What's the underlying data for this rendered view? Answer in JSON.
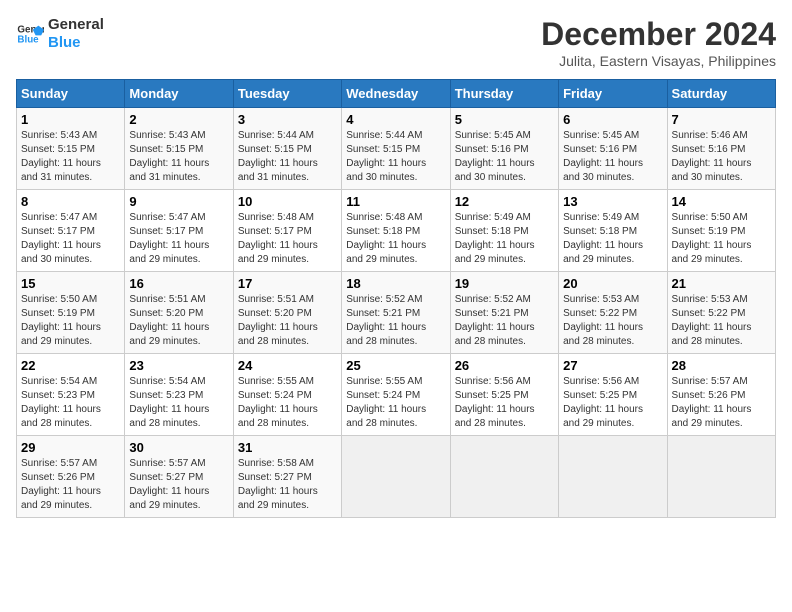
{
  "logo": {
    "line1": "General",
    "line2": "Blue"
  },
  "title": "December 2024",
  "subtitle": "Julita, Eastern Visayas, Philippines",
  "days_of_week": [
    "Sunday",
    "Monday",
    "Tuesday",
    "Wednesday",
    "Thursday",
    "Friday",
    "Saturday"
  ],
  "weeks": [
    [
      {
        "day": 1,
        "info": "Sunrise: 5:43 AM\nSunset: 5:15 PM\nDaylight: 11 hours\nand 31 minutes."
      },
      {
        "day": 2,
        "info": "Sunrise: 5:43 AM\nSunset: 5:15 PM\nDaylight: 11 hours\nand 31 minutes."
      },
      {
        "day": 3,
        "info": "Sunrise: 5:44 AM\nSunset: 5:15 PM\nDaylight: 11 hours\nand 31 minutes."
      },
      {
        "day": 4,
        "info": "Sunrise: 5:44 AM\nSunset: 5:15 PM\nDaylight: 11 hours\nand 30 minutes."
      },
      {
        "day": 5,
        "info": "Sunrise: 5:45 AM\nSunset: 5:16 PM\nDaylight: 11 hours\nand 30 minutes."
      },
      {
        "day": 6,
        "info": "Sunrise: 5:45 AM\nSunset: 5:16 PM\nDaylight: 11 hours\nand 30 minutes."
      },
      {
        "day": 7,
        "info": "Sunrise: 5:46 AM\nSunset: 5:16 PM\nDaylight: 11 hours\nand 30 minutes."
      }
    ],
    [
      {
        "day": 8,
        "info": "Sunrise: 5:47 AM\nSunset: 5:17 PM\nDaylight: 11 hours\nand 30 minutes."
      },
      {
        "day": 9,
        "info": "Sunrise: 5:47 AM\nSunset: 5:17 PM\nDaylight: 11 hours\nand 29 minutes."
      },
      {
        "day": 10,
        "info": "Sunrise: 5:48 AM\nSunset: 5:17 PM\nDaylight: 11 hours\nand 29 minutes."
      },
      {
        "day": 11,
        "info": "Sunrise: 5:48 AM\nSunset: 5:18 PM\nDaylight: 11 hours\nand 29 minutes."
      },
      {
        "day": 12,
        "info": "Sunrise: 5:49 AM\nSunset: 5:18 PM\nDaylight: 11 hours\nand 29 minutes."
      },
      {
        "day": 13,
        "info": "Sunrise: 5:49 AM\nSunset: 5:18 PM\nDaylight: 11 hours\nand 29 minutes."
      },
      {
        "day": 14,
        "info": "Sunrise: 5:50 AM\nSunset: 5:19 PM\nDaylight: 11 hours\nand 29 minutes."
      }
    ],
    [
      {
        "day": 15,
        "info": "Sunrise: 5:50 AM\nSunset: 5:19 PM\nDaylight: 11 hours\nand 29 minutes."
      },
      {
        "day": 16,
        "info": "Sunrise: 5:51 AM\nSunset: 5:20 PM\nDaylight: 11 hours\nand 29 minutes."
      },
      {
        "day": 17,
        "info": "Sunrise: 5:51 AM\nSunset: 5:20 PM\nDaylight: 11 hours\nand 28 minutes."
      },
      {
        "day": 18,
        "info": "Sunrise: 5:52 AM\nSunset: 5:21 PM\nDaylight: 11 hours\nand 28 minutes."
      },
      {
        "day": 19,
        "info": "Sunrise: 5:52 AM\nSunset: 5:21 PM\nDaylight: 11 hours\nand 28 minutes."
      },
      {
        "day": 20,
        "info": "Sunrise: 5:53 AM\nSunset: 5:22 PM\nDaylight: 11 hours\nand 28 minutes."
      },
      {
        "day": 21,
        "info": "Sunrise: 5:53 AM\nSunset: 5:22 PM\nDaylight: 11 hours\nand 28 minutes."
      }
    ],
    [
      {
        "day": 22,
        "info": "Sunrise: 5:54 AM\nSunset: 5:23 PM\nDaylight: 11 hours\nand 28 minutes."
      },
      {
        "day": 23,
        "info": "Sunrise: 5:54 AM\nSunset: 5:23 PM\nDaylight: 11 hours\nand 28 minutes."
      },
      {
        "day": 24,
        "info": "Sunrise: 5:55 AM\nSunset: 5:24 PM\nDaylight: 11 hours\nand 28 minutes."
      },
      {
        "day": 25,
        "info": "Sunrise: 5:55 AM\nSunset: 5:24 PM\nDaylight: 11 hours\nand 28 minutes."
      },
      {
        "day": 26,
        "info": "Sunrise: 5:56 AM\nSunset: 5:25 PM\nDaylight: 11 hours\nand 28 minutes."
      },
      {
        "day": 27,
        "info": "Sunrise: 5:56 AM\nSunset: 5:25 PM\nDaylight: 11 hours\nand 29 minutes."
      },
      {
        "day": 28,
        "info": "Sunrise: 5:57 AM\nSunset: 5:26 PM\nDaylight: 11 hours\nand 29 minutes."
      }
    ],
    [
      {
        "day": 29,
        "info": "Sunrise: 5:57 AM\nSunset: 5:26 PM\nDaylight: 11 hours\nand 29 minutes."
      },
      {
        "day": 30,
        "info": "Sunrise: 5:57 AM\nSunset: 5:27 PM\nDaylight: 11 hours\nand 29 minutes."
      },
      {
        "day": 31,
        "info": "Sunrise: 5:58 AM\nSunset: 5:27 PM\nDaylight: 11 hours\nand 29 minutes."
      },
      null,
      null,
      null,
      null
    ]
  ]
}
